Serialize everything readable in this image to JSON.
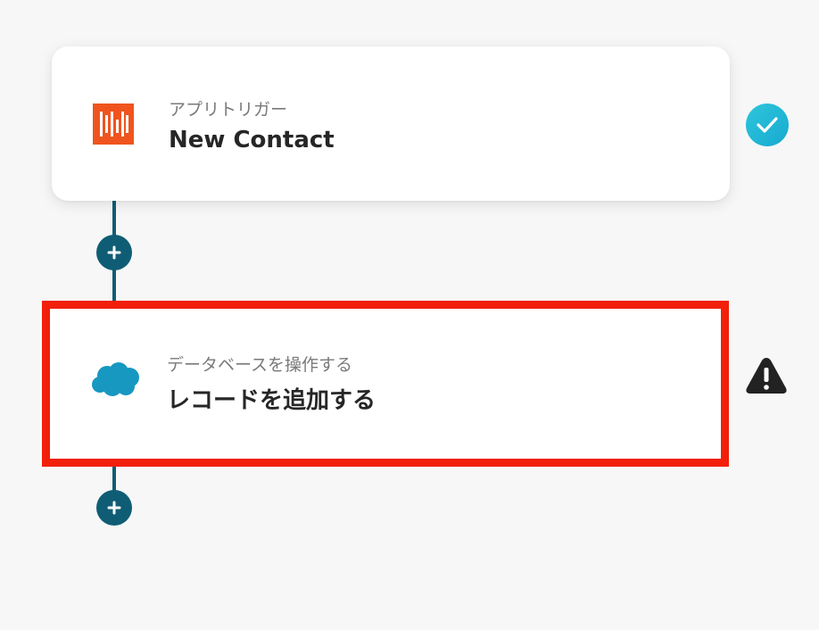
{
  "flow": {
    "steps": [
      {
        "subtitle": "アプリトリガー",
        "title": "New Contact",
        "app_icon": "hubspot-style-app-icon",
        "status": "completed",
        "status_icon": "check-circle-icon"
      },
      {
        "subtitle": "データベースを操作する",
        "title": "レコードを追加する",
        "app_icon": "salesforce-cloud-icon",
        "status": "warning",
        "status_icon": "warning-triangle-icon",
        "selected": true
      }
    ],
    "add_step_icon": "plus-icon"
  },
  "colors": {
    "connector": "#0f5d75",
    "check": "#1fb6d6",
    "warning": "#222222",
    "selection_border": "#f21f0a",
    "app1_brand": "#f0541e",
    "salesforce_blue": "#1798c1"
  }
}
